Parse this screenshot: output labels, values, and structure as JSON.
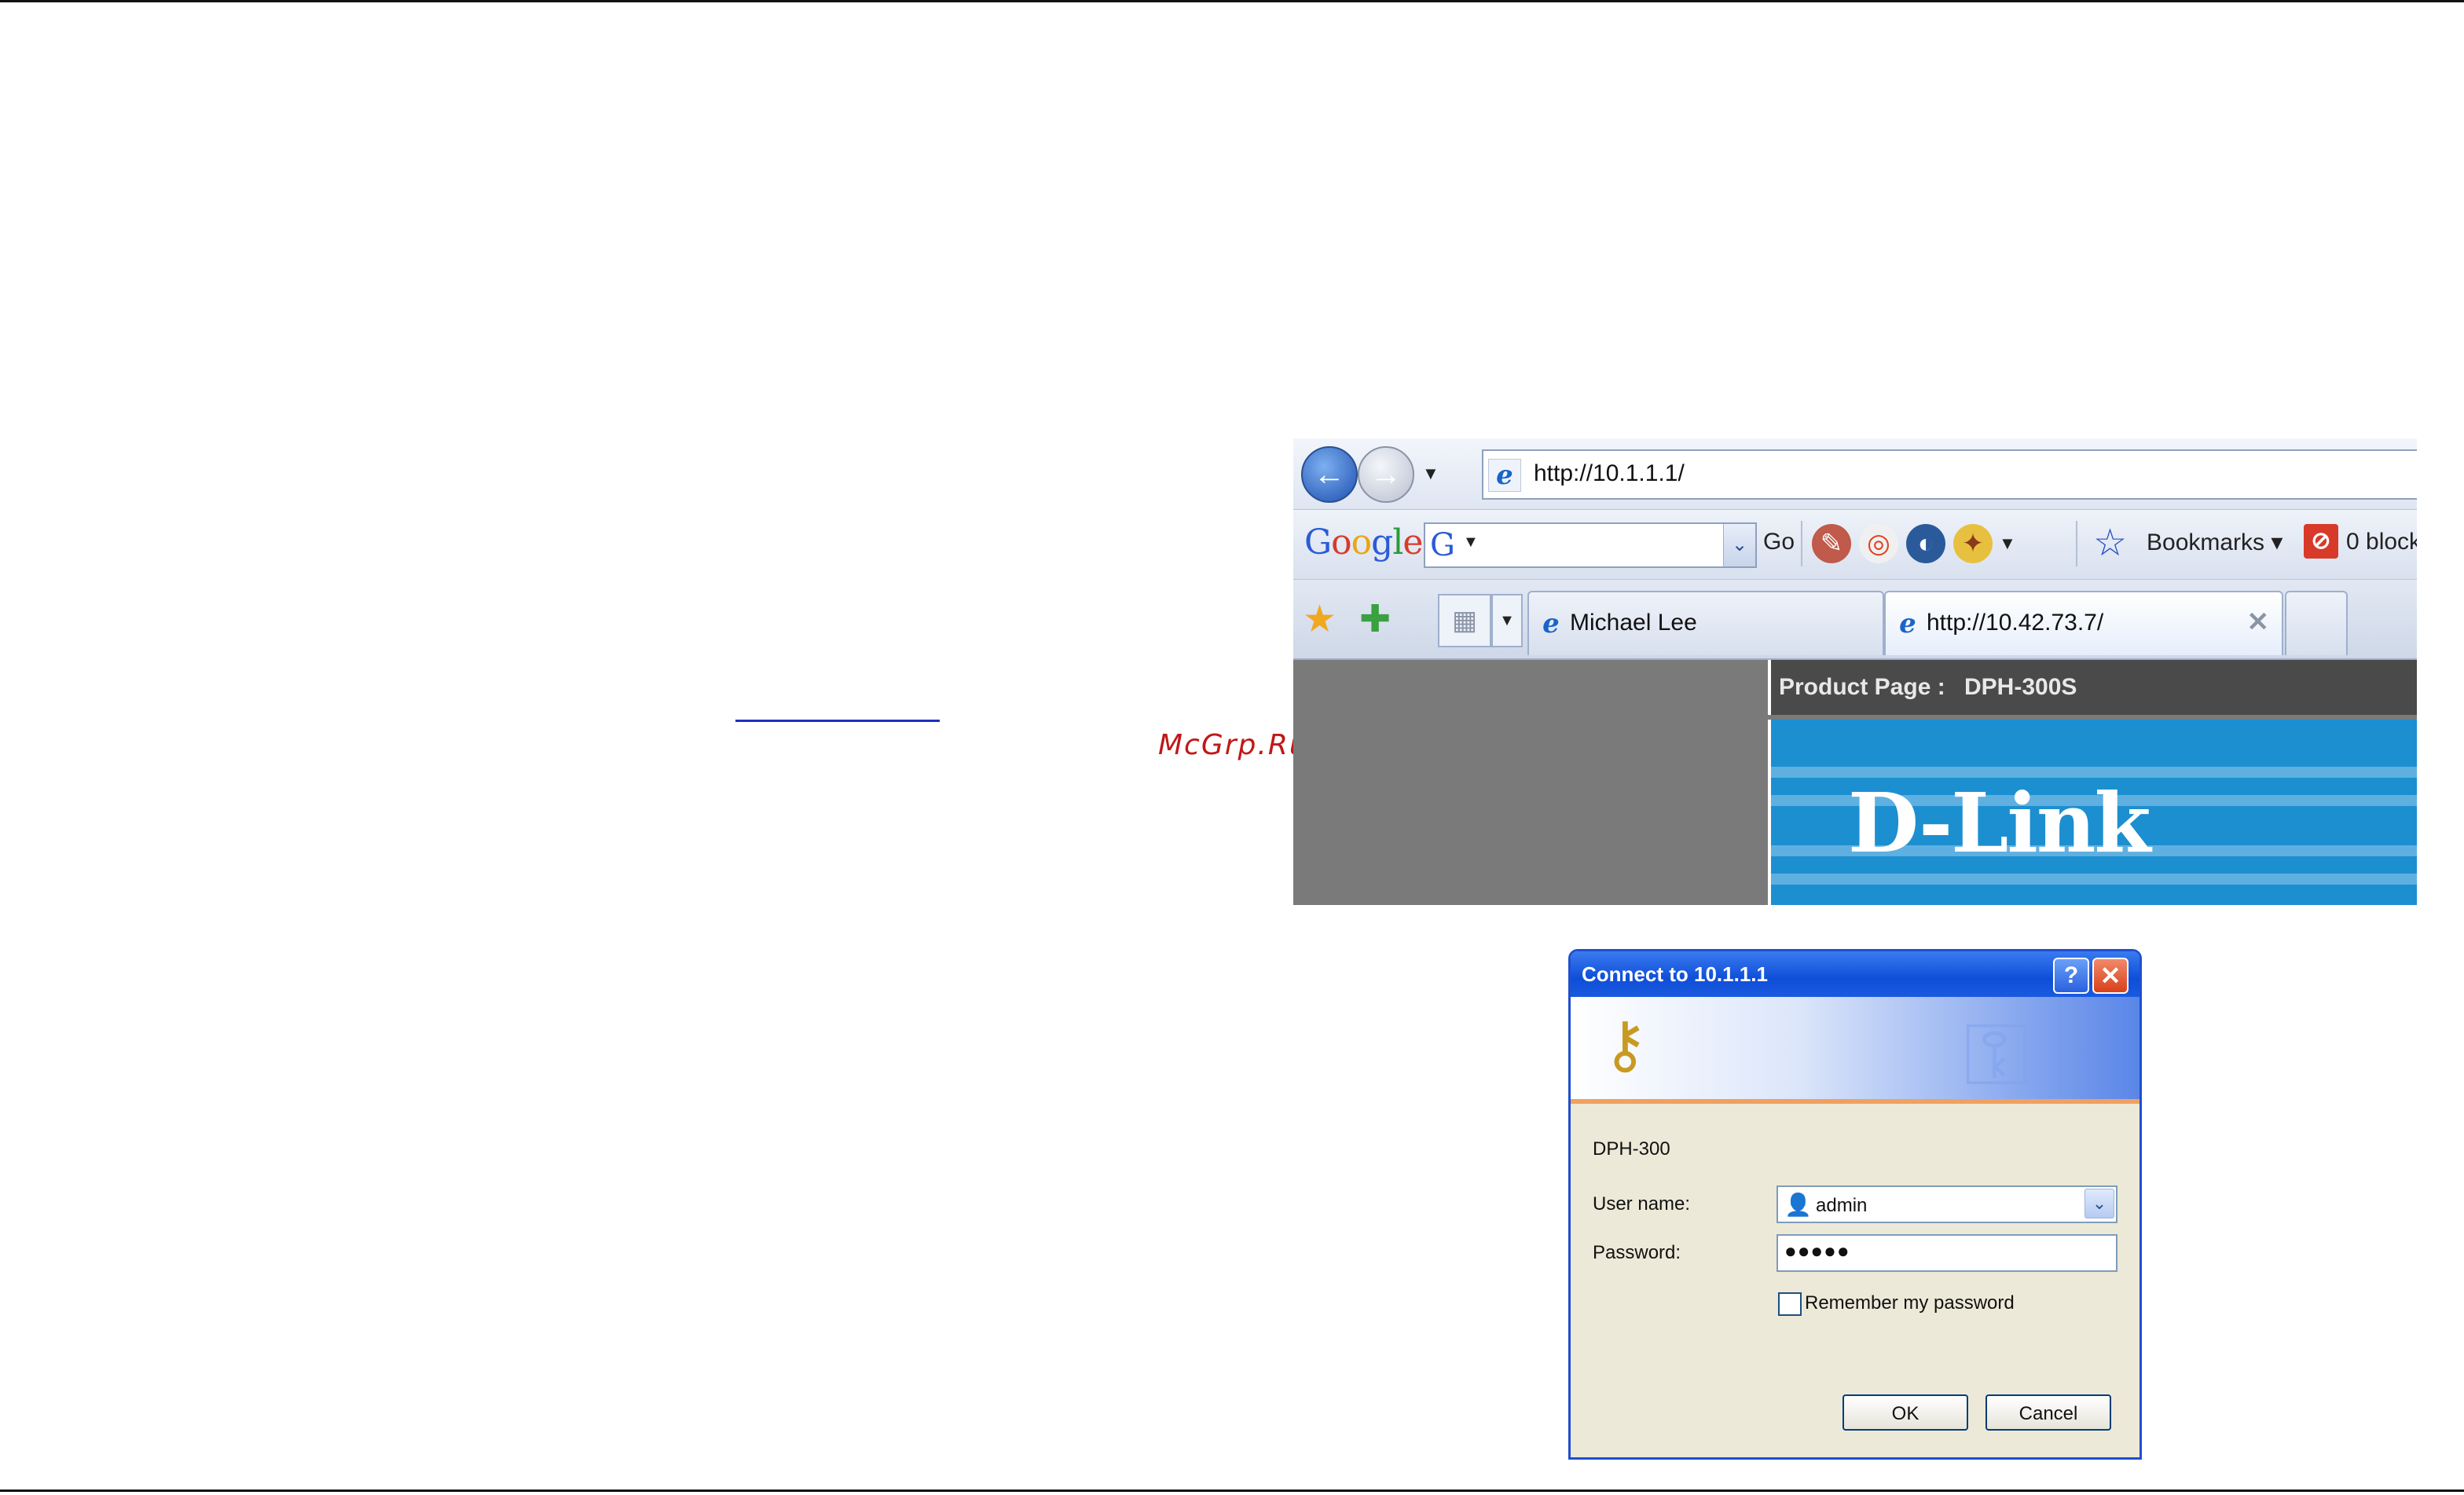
{
  "watermark": "McGrp.Ru",
  "browser": {
    "address": "http://10.1.1.1/",
    "google_logo": [
      "G",
      "o",
      "o",
      "g",
      "l",
      "e"
    ],
    "search_engine_glyph": "G",
    "go_label": "Go",
    "bookmarks_label": "Bookmarks",
    "blocked_label": "0 block",
    "tabs": [
      {
        "label": "Michael Lee"
      },
      {
        "label": "http://10.42.73.7/"
      }
    ],
    "page": {
      "product_label": "Product Page :",
      "product_value": "DPH-300S",
      "brand": "D-Link",
      "brand_color": "#1c8fd0"
    }
  },
  "dialog": {
    "title": "Connect to 10.1.1.1",
    "device": "DPH-300",
    "username_label": "User name:",
    "username_value": "admin",
    "password_label": "Password:",
    "password_value": "●●●●●",
    "remember_label": "Remember my password",
    "ok_label": "OK",
    "cancel_label": "Cancel",
    "help_glyph": "?",
    "close_glyph": "✕"
  }
}
